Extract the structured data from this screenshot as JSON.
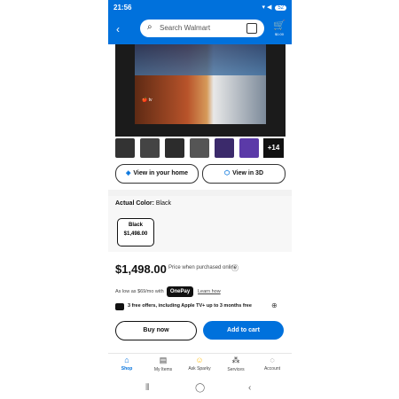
{
  "status": {
    "time": "21:56",
    "battery": "52"
  },
  "search": {
    "placeholder": "Search Walmart"
  },
  "cart": {
    "price": "$0.00"
  },
  "thumbnails": {
    "more_label": "+14"
  },
  "actions": {
    "view_home": "View in your home",
    "view_3d": "View in 3D"
  },
  "color": {
    "label": "Actual Color:",
    "value": "Black"
  },
  "variant": {
    "name": "Black",
    "price": "$1,498.00"
  },
  "price": {
    "main": "$1,498.00",
    "note": "Price when purchased online"
  },
  "payment": {
    "text": "As low as $69/mo with",
    "onepay": "OnePay",
    "learn": "Learn how"
  },
  "offer": {
    "text": "3 free offers, including Apple TV+ up to 3 months free"
  },
  "buttons": {
    "buy_now": "Buy now",
    "add_to_cart": "Add to cart"
  },
  "bottom_nav": [
    {
      "label": "Shop",
      "icon": "home-icon",
      "glyph": "⌂"
    },
    {
      "label": "My Items",
      "icon": "my-items-icon",
      "glyph": "▤"
    },
    {
      "label": "Ask Sparky",
      "icon": "sparky-icon",
      "glyph": "☺"
    },
    {
      "label": "Services",
      "icon": "services-icon",
      "glyph": "⁂"
    },
    {
      "label": "Account",
      "icon": "account-icon",
      "glyph": "◌"
    }
  ],
  "colors": {
    "brand": "#0071dc",
    "dark": "#111111"
  }
}
